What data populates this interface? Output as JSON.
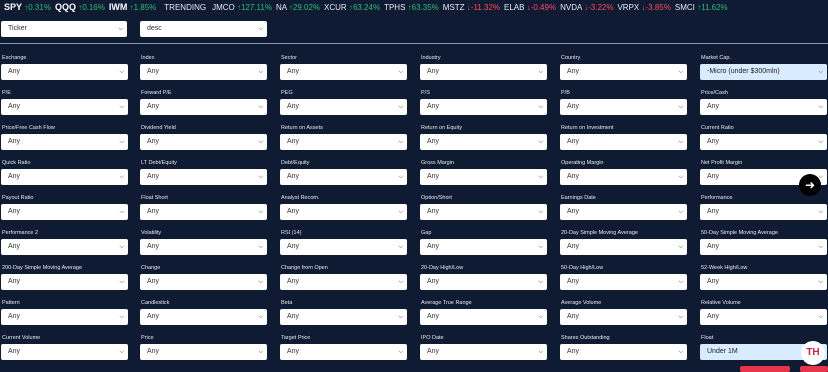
{
  "ticker": {
    "items": [
      {
        "symbol": "SPY",
        "change": "0.31%",
        "dir": "up",
        "big": true
      },
      {
        "symbol": "QQQ",
        "change": "0.16%",
        "dir": "up",
        "big": true
      },
      {
        "symbol": "IWM",
        "change": "1.85%",
        "dir": "up",
        "big": true
      }
    ],
    "trending_label": "TRENDING",
    "trending": [
      {
        "symbol": "JMCO",
        "change": "127.11%",
        "dir": "up"
      },
      {
        "symbol": "NA",
        "change": "29.02%",
        "dir": "up"
      },
      {
        "symbol": "XCUR",
        "change": "63.24%",
        "dir": "up"
      },
      {
        "symbol": "TPHS",
        "change": "63.35%",
        "dir": "up"
      },
      {
        "symbol": "MSTZ",
        "change": "-11.32%",
        "dir": "down"
      },
      {
        "symbol": "ELAB",
        "change": "-0.49%",
        "dir": "down"
      },
      {
        "symbol": "NVDA",
        "change": "-3.22%",
        "dir": "down"
      },
      {
        "symbol": "VRPX",
        "change": "-3.85%",
        "dir": "down"
      },
      {
        "symbol": "SMCI",
        "change": "11.62%",
        "dir": "up"
      }
    ],
    "up_color": "#2fbf71",
    "down_color": "#ff4d5e"
  },
  "sort": {
    "field_value": "Ticker",
    "order_value": "desc"
  },
  "filters": [
    {
      "label": "Exchange",
      "value": "Any"
    },
    {
      "label": "Index",
      "value": "Any"
    },
    {
      "label": "Sector",
      "value": "Any"
    },
    {
      "label": "Industry",
      "value": "Any"
    },
    {
      "label": "Country",
      "value": "Any"
    },
    {
      "label": "Market Cap.",
      "value": "-Micro (under $300mln)",
      "hl": true
    },
    {
      "label": "P/E",
      "value": "Any"
    },
    {
      "label": "Forward P/E",
      "value": "Any"
    },
    {
      "label": "PEG",
      "value": "Any"
    },
    {
      "label": "P/S",
      "value": "Any"
    },
    {
      "label": "P/B",
      "value": "Any"
    },
    {
      "label": "Price/Cash",
      "value": "Any"
    },
    {
      "label": "Price/Free Cash Flow",
      "value": "Any"
    },
    {
      "label": "Dividend Yield",
      "value": "Any"
    },
    {
      "label": "Return on Assets",
      "value": "Any"
    },
    {
      "label": "Return on Equity",
      "value": "Any"
    },
    {
      "label": "Return on Investment",
      "value": "Any"
    },
    {
      "label": "Current Ratio",
      "value": "Any"
    },
    {
      "label": "Quick Ratio",
      "value": "Any"
    },
    {
      "label": "LT Debt/Equity",
      "value": "Any"
    },
    {
      "label": "Debt/Equity",
      "value": "Any"
    },
    {
      "label": "Gross Margin",
      "value": "Any"
    },
    {
      "label": "Operating Margin",
      "value": "Any"
    },
    {
      "label": "Net Profit Margin",
      "value": "Any"
    },
    {
      "label": "Payout Ratio",
      "value": "Any"
    },
    {
      "label": "Float Short",
      "value": "Any"
    },
    {
      "label": "Analyst Recom.",
      "value": "Any"
    },
    {
      "label": "Option/Short",
      "value": "Any"
    },
    {
      "label": "Earnings Date",
      "value": "Any"
    },
    {
      "label": "Performance",
      "value": "Any"
    },
    {
      "label": "Performance 2",
      "value": "Any"
    },
    {
      "label": "Volatility",
      "value": "Any"
    },
    {
      "label": "RSI (14)",
      "value": "Any"
    },
    {
      "label": "Gap",
      "value": "Any"
    },
    {
      "label": "20-Day Simple Moving Average",
      "value": "Any"
    },
    {
      "label": "50-Day Simple Moving Average",
      "value": "Any"
    },
    {
      "label": "200-Day Simple Moving Average",
      "value": "Any"
    },
    {
      "label": "Change",
      "value": "Any"
    },
    {
      "label": "Change from Open",
      "value": "Any"
    },
    {
      "label": "20-Day High/Low",
      "value": "Any"
    },
    {
      "label": "50-Day High/Low",
      "value": "Any"
    },
    {
      "label": "52-Week High/Low",
      "value": "Any"
    },
    {
      "label": "Pattern",
      "value": "Any"
    },
    {
      "label": "Candlestick",
      "value": "Any"
    },
    {
      "label": "Beta",
      "value": "Any"
    },
    {
      "label": "Average True Range",
      "value": "Any"
    },
    {
      "label": "Average Volume",
      "value": "Any"
    },
    {
      "label": "Relative Volume",
      "value": "Any"
    },
    {
      "label": "Current Volume",
      "value": "Any"
    },
    {
      "label": "Price",
      "value": "Any"
    },
    {
      "label": "Target Price",
      "value": "Any"
    },
    {
      "label": "IPO Date",
      "value": "Any"
    },
    {
      "label": "Shares Outstanding",
      "value": "Any"
    },
    {
      "label": "Float",
      "value": "Under 1M",
      "hl": true
    }
  ],
  "logo_text": "TH"
}
